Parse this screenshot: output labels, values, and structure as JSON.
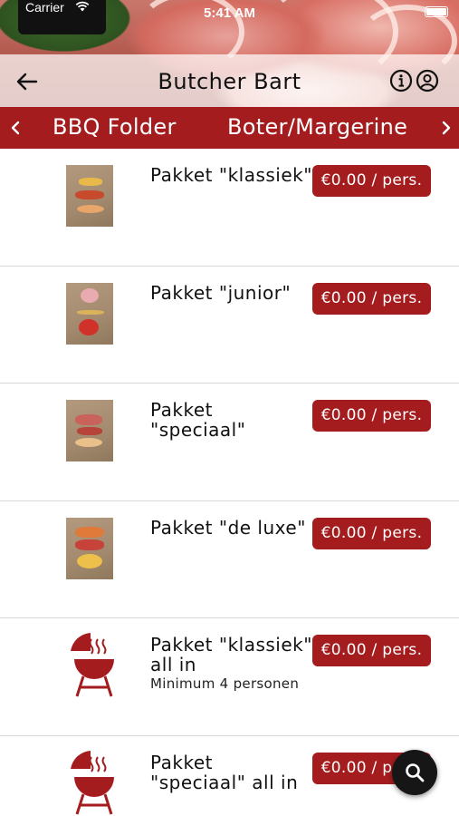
{
  "status": {
    "carrier": "Carrier",
    "time": "5:41 AM"
  },
  "nav": {
    "title": "Butcher Bart"
  },
  "categories": [
    "BBQ Folder",
    "Boter/Margerine"
  ],
  "products": [
    {
      "name": "Pakket \"klassiek\"",
      "subtitle": "",
      "price": "€0.00 / pers.",
      "image": "photo-thumbnail"
    },
    {
      "name": "Pakket \"junior\"",
      "subtitle": "",
      "price": "€0.00 / pers.",
      "image": "photo-thumbnail"
    },
    {
      "name": "Pakket \"speciaal\"",
      "subtitle": "",
      "price": "€0.00 / pers.",
      "image": "photo-thumbnail"
    },
    {
      "name": "Pakket \"de luxe\"",
      "subtitle": "",
      "price": "€0.00 / pers.",
      "image": "photo-thumbnail"
    },
    {
      "name": "Pakket \"klassiek\" all in",
      "subtitle": "Minimum 4 personen",
      "price": "€0.00 / pers.",
      "image": "grill-icon"
    },
    {
      "name": "Pakket \"speciaal\" all in",
      "subtitle": "",
      "price": "€0.00 / pers.",
      "image": "grill-icon"
    }
  ],
  "icons": {
    "back": "arrow-left-icon",
    "info": "info-circle-icon",
    "account": "account-circle-icon",
    "prev": "chevron-left-icon",
    "next": "chevron-right-icon",
    "search": "search-icon"
  },
  "colors": {
    "accent": "#a51c1f",
    "fab": "#161616",
    "divider": "#d8d8d8"
  }
}
